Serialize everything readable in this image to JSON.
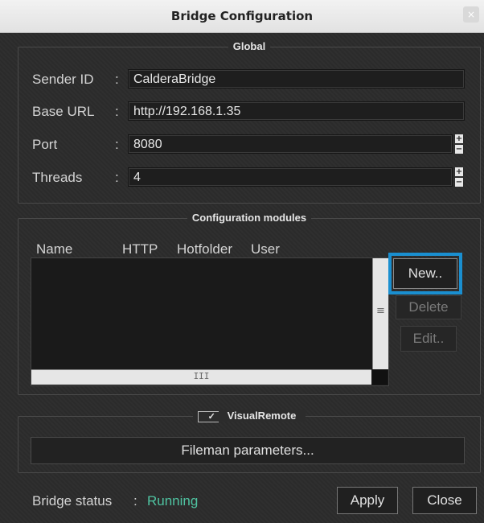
{
  "window": {
    "title": "Bridge Configuration",
    "close_glyph": "×"
  },
  "global": {
    "title": "Global",
    "fields": [
      {
        "label": "Sender ID",
        "value": "CalderaBridge"
      },
      {
        "label": "Base URL",
        "value": "http://192.168.1.35"
      },
      {
        "label": "Port",
        "value": "8080"
      },
      {
        "label": "Threads",
        "value": "4"
      }
    ],
    "separator": ":"
  },
  "modules": {
    "title": "Configuration modules",
    "columns": [
      "Name",
      "HTTP",
      "Hotfolder",
      "User"
    ],
    "rows": [],
    "buttons": {
      "new": "New..",
      "delete": "Delete",
      "edit": "Edit.."
    },
    "hscroll_grip": "III",
    "vscroll_grip": "≡"
  },
  "visualremote": {
    "title": "VisualRemote",
    "checked": true,
    "check_glyph": "✓",
    "fileman_label": "Fileman parameters..."
  },
  "status": {
    "label": "Bridge status",
    "separator": ":",
    "value": "Running",
    "value_color": "#4fc3a1"
  },
  "footer": {
    "apply": "Apply",
    "close": "Close"
  },
  "colors": {
    "highlight": "#1a8fd0",
    "background": "#2c2c2c"
  }
}
